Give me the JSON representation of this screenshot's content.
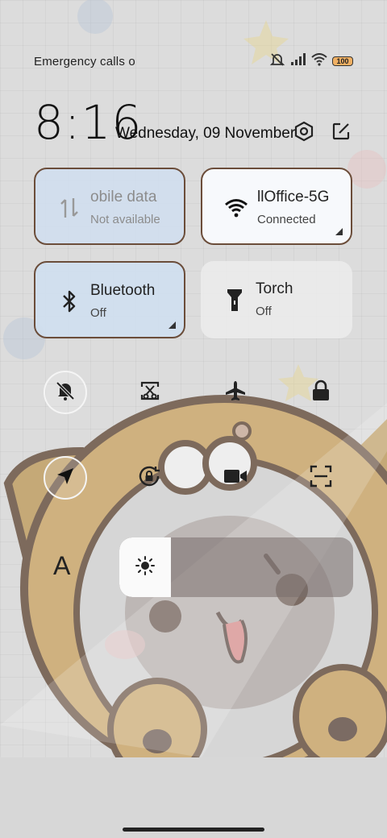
{
  "status_bar": {
    "carrier_text": "Emergency calls o",
    "battery": "100",
    "icons": [
      "mute-icon",
      "signal-icon",
      "wifi-icon",
      "battery-icon"
    ]
  },
  "header": {
    "time": "8:16",
    "date": "Wednesday, 09 November",
    "buttons": [
      "settings-icon",
      "edit-icon"
    ]
  },
  "tiles": {
    "mobile_data": {
      "title": "obile data",
      "subtitle": "Not available",
      "icon": "mobile-data-icon"
    },
    "wifi": {
      "title": "llOffice-5G",
      "subtitle": "Connected",
      "icon": "wifi-icon"
    },
    "bluetooth": {
      "title": "Bluetooth",
      "subtitle": "Off",
      "icon": "bluetooth-icon"
    },
    "torch": {
      "title": "Torch",
      "subtitle": "Off",
      "icon": "torch-icon"
    }
  },
  "toggles_row1": [
    "silent-icon",
    "screenshot-icon",
    "airplane-icon",
    "lock-icon"
  ],
  "toggles_row2": [
    "location-icon",
    "rotation-lock-icon",
    "screen-record-icon",
    "scanner-icon"
  ],
  "brightness": {
    "level": 0.22,
    "icon": "sun-icon"
  },
  "font_size_label": "A",
  "colors": {
    "accent_border": "#6b4d3a",
    "tile_active": "#d0deee"
  }
}
